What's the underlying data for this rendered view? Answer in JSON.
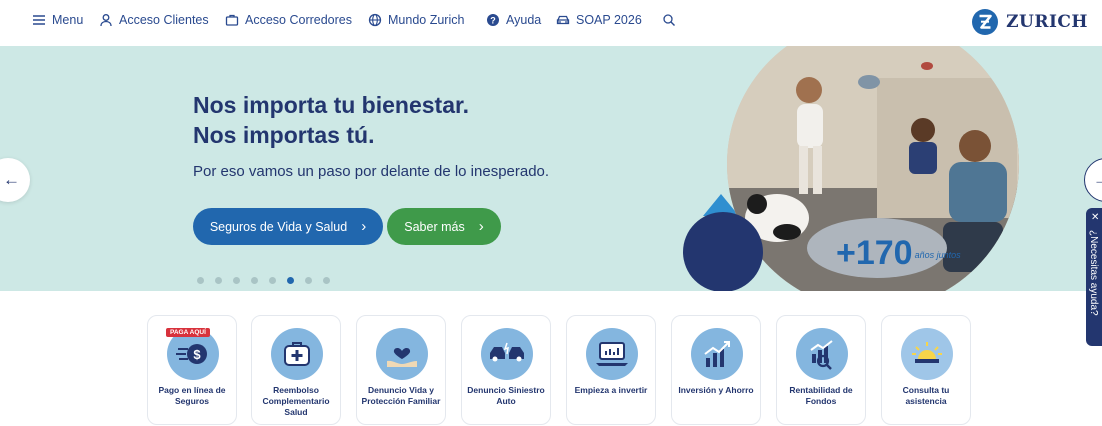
{
  "nav": {
    "menu": "Menu",
    "clientes": "Acceso Clientes",
    "corredores": "Acceso Corredores",
    "mundo": "Mundo Zurich",
    "ayuda": "Ayuda",
    "soap": "SOAP 2026"
  },
  "brand": {
    "name": "ZURICH",
    "color": "#2167ae"
  },
  "hero": {
    "title_line1": "Nos importa tu bienestar.",
    "title_line2": "Nos importas tú.",
    "subtitle": "Por eso vamos un paso por delante de lo inesperado.",
    "primary_button": "Seguros de Vida y Salud",
    "secondary_button": "Saber más",
    "badge_number": "+170",
    "badge_text": "años juntos",
    "slide_count": 8,
    "active_slide": 6
  },
  "help": {
    "label": "¿Necesitas ayuda?"
  },
  "cards": [
    {
      "label": "Pago en línea de Seguros",
      "badge": "PAGA AQUÍ",
      "icon": "dollar-payment-icon"
    },
    {
      "label": "Reembolso Complementario Salud",
      "icon": "medical-kit-icon"
    },
    {
      "label": "Denuncio Vida y Protección Familiar",
      "icon": "heart-hand-icon"
    },
    {
      "label": "Denuncio Siniestro Auto",
      "icon": "car-crash-icon"
    },
    {
      "label": "Empieza a invertir",
      "icon": "laptop-chart-icon"
    },
    {
      "label": "Inversión y Ahorro",
      "icon": "growth-chart-icon"
    },
    {
      "label": "Rentabilidad de Fondos",
      "icon": "chart-search-icon"
    },
    {
      "label": "Consulta tu asistencia",
      "icon": "sunrise-alert-icon"
    }
  ],
  "colors": {
    "navy": "#23366f",
    "blue": "#2167ae",
    "green": "#3f9a4a",
    "mint": "#cde8e5",
    "red": "#d8323c"
  }
}
